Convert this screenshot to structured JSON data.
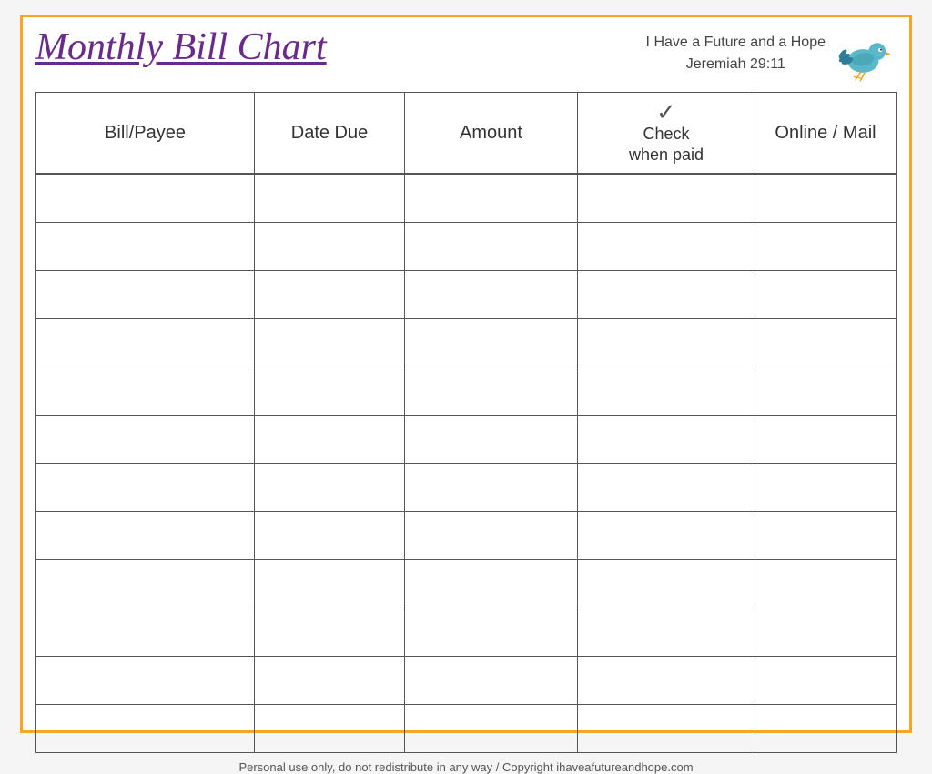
{
  "header": {
    "title": "Monthly Bill Chart",
    "scripture_line1": "I Have a Future and a Hope",
    "scripture_line2": "Jeremiah 29:11"
  },
  "table": {
    "columns": [
      {
        "id": "bill-payee",
        "label": "Bill/Payee"
      },
      {
        "id": "date-due",
        "label": "Date Due"
      },
      {
        "id": "amount",
        "label": "Amount"
      },
      {
        "id": "check-when-paid",
        "label": "Check\nwhen paid",
        "has_checkmark": true
      },
      {
        "id": "online-mail",
        "label": "Online / Mail"
      }
    ],
    "row_count": 12
  },
  "footer": {
    "text": "Personal use only, do not redistribute in any way / Copyright ihaveafutureandhope.com"
  },
  "colors": {
    "border": "#f5a623",
    "title": "#6a2a8a",
    "table_border": "#555555"
  }
}
